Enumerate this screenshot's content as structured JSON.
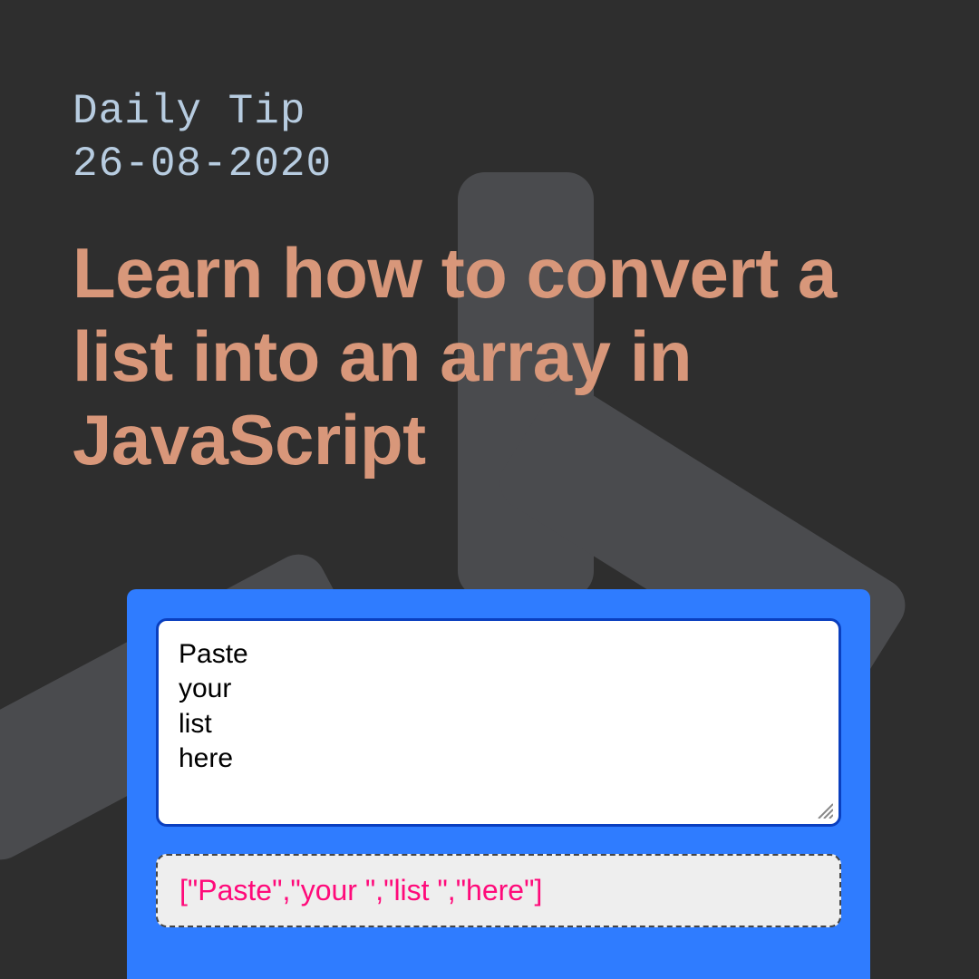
{
  "eyebrow_line1": "Daily Tip",
  "eyebrow_line2": "26-08-2020",
  "title": "Learn how to convert a list into an array in JavaScript",
  "demo": {
    "textarea_value": "Paste\nyour\nlist\nhere",
    "output_text": "[\"Paste\",\"your \",\"list \",\"here\"]"
  }
}
